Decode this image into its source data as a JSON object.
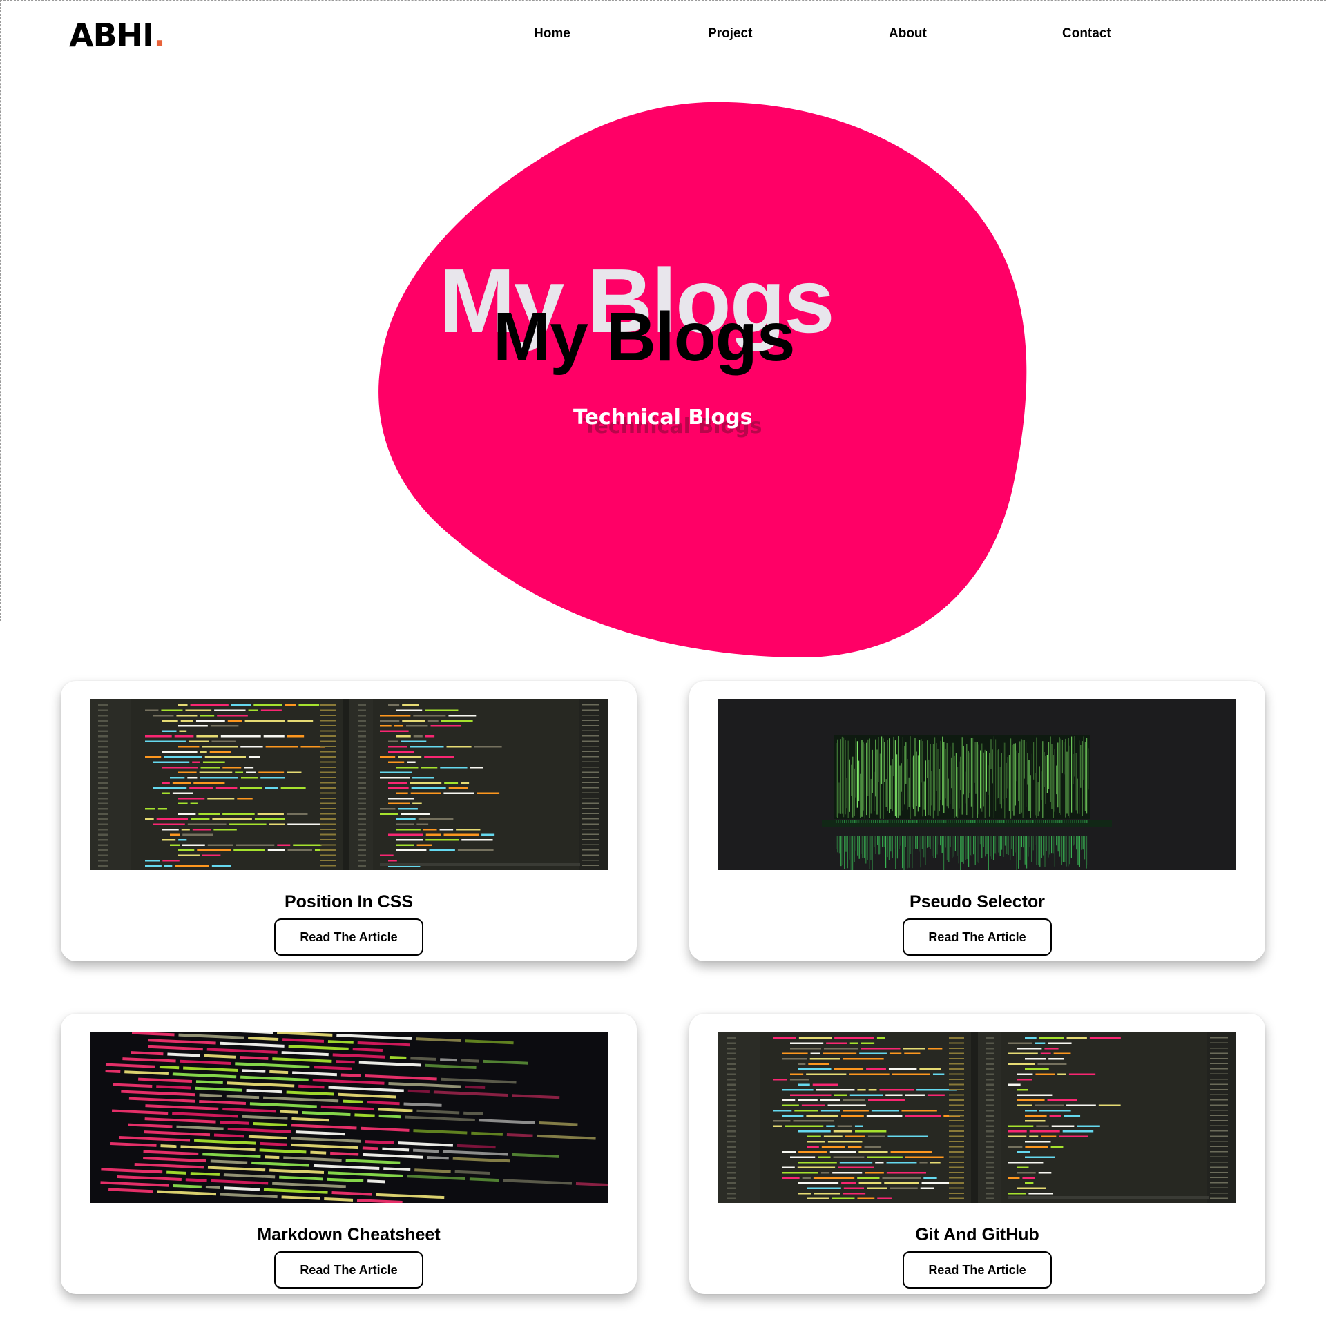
{
  "header": {
    "logo_text": "ABHI",
    "logo_dot": ".",
    "nav": [
      "Home",
      "Project",
      "About",
      "Contact"
    ]
  },
  "hero": {
    "title_shadow": "My Blogs",
    "title": "My Blogs",
    "subtitle": "Technical Blogs",
    "blob_color": "#ff0066"
  },
  "colors": {
    "accent": "#e8623a",
    "blob": "#ff0066"
  },
  "cards": [
    {
      "title": "Position In CSS",
      "button": "Read The Article",
      "image": "code-editor-screenshot"
    },
    {
      "title": "Pseudo Selector",
      "button": "Read The Article",
      "image": "matrix-code-screen"
    },
    {
      "title": "Markdown Cheatsheet",
      "button": "Read The Article",
      "image": "html-code-closeup"
    },
    {
      "title": "Git And GitHub",
      "button": "Read The Article",
      "image": "code-editor-screenshot"
    }
  ]
}
